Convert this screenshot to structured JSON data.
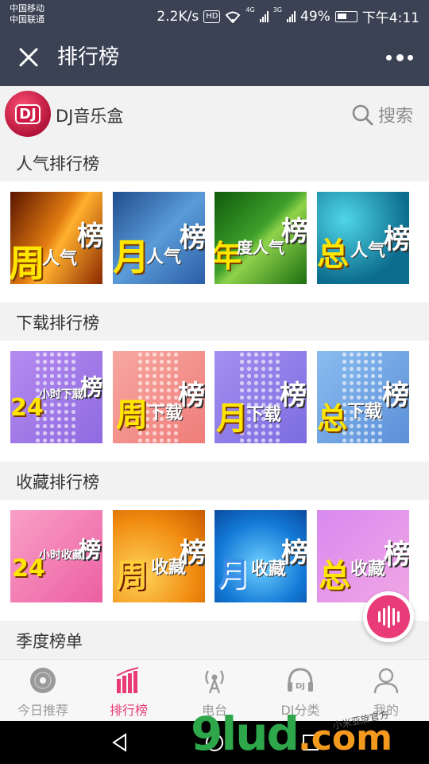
{
  "status": {
    "carrier1": "中国移动",
    "carrier2": "中国联通",
    "speed": "2.2K/s",
    "hd": "HD",
    "net1": "4G",
    "net2": "3G",
    "battery": "49%",
    "time": "下午4:11"
  },
  "titlebar": {
    "title": "排行榜"
  },
  "app": {
    "name": "DJ音乐盒",
    "logo_text": "DJ",
    "search_label": "搜索"
  },
  "sections": [
    {
      "title": "人气排行榜",
      "tiles": [
        {
          "big": "周",
          "small": "人气",
          "bang": "榜"
        },
        {
          "big": "月",
          "small": "人气",
          "bang": "榜"
        },
        {
          "big": "年",
          "small": "度人气",
          "bang": "榜"
        },
        {
          "big": "总",
          "small": "人气",
          "bang": "榜"
        }
      ]
    },
    {
      "title": "下载排行榜",
      "tiles": [
        {
          "big": "24",
          "small": "小时下载",
          "bang": "榜"
        },
        {
          "big": "周",
          "small": "下载",
          "bang": "榜"
        },
        {
          "big": "月",
          "small": "下载",
          "bang": "榜"
        },
        {
          "big": "总",
          "small": "下载",
          "bang": "榜"
        }
      ]
    },
    {
      "title": "收藏排行榜",
      "tiles": [
        {
          "big": "24",
          "small": "小时收藏",
          "bang": "榜"
        },
        {
          "big": "周",
          "small": "收藏",
          "bang": "榜"
        },
        {
          "big": "月",
          "small": "收藏",
          "bang": "榜"
        },
        {
          "big": "总",
          "small": "收藏",
          "bang": "榜"
        }
      ]
    },
    {
      "title": "季度榜单",
      "tiles": []
    }
  ],
  "tabs": [
    {
      "label": "今日推荐",
      "icon": "disc-icon"
    },
    {
      "label": "排行榜",
      "icon": "chart-bars-icon"
    },
    {
      "label": "电台",
      "icon": "radio-tower-icon"
    },
    {
      "label": "DJ分类",
      "icon": "dj-headphones-icon"
    },
    {
      "label": "我的",
      "icon": "user-icon"
    }
  ],
  "active_tab": "排行榜",
  "colors": {
    "header_bg": "#3a4254",
    "accent": "#e93b77"
  },
  "watermark": {
    "main": "9lud",
    "domain": ".com",
    "small": "小米亚旋官方"
  }
}
